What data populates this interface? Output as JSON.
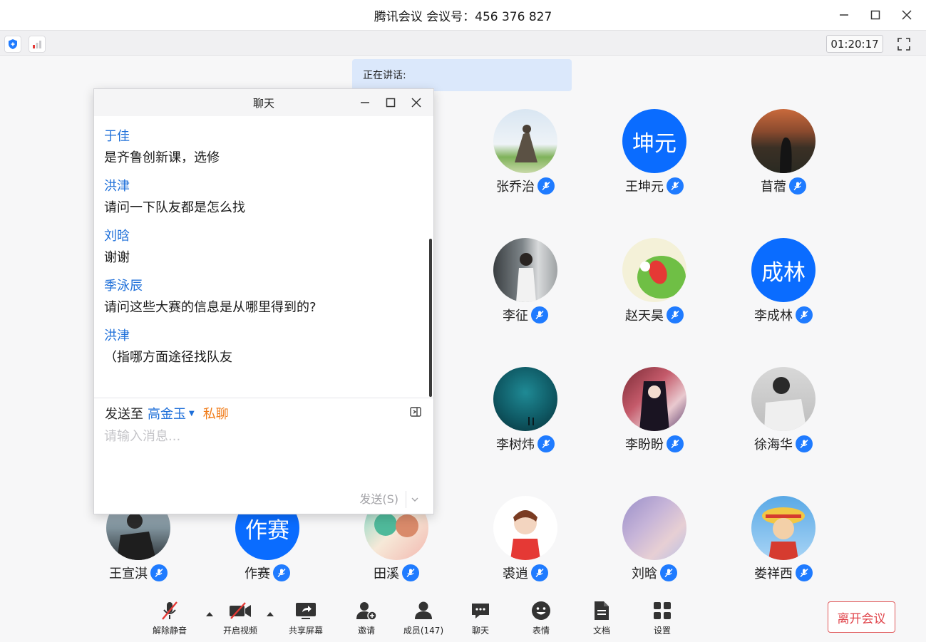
{
  "window": {
    "title": "腾讯会议 会议号：456 376 827"
  },
  "status": {
    "timer": "01:20:17"
  },
  "speaking": {
    "label": "正在讲话:"
  },
  "participants": [
    {
      "name": "张乔治",
      "avatar_text": ""
    },
    {
      "name": "王坤元",
      "avatar_text": "坤元"
    },
    {
      "name": "苜蓿",
      "avatar_text": ""
    },
    {
      "name": "李征",
      "avatar_text": ""
    },
    {
      "name": "赵天昊",
      "avatar_text": ""
    },
    {
      "name": "李成林",
      "avatar_text": "成林"
    },
    {
      "name": "李树炜",
      "avatar_text": ""
    },
    {
      "name": "李盼盼",
      "avatar_text": ""
    },
    {
      "name": "徐海华",
      "avatar_text": ""
    },
    {
      "name": "王宣淇",
      "avatar_text": ""
    },
    {
      "name": "作赛",
      "avatar_text": "作赛"
    },
    {
      "name": "田溪",
      "avatar_text": ""
    },
    {
      "name": "裘逍",
      "avatar_text": ""
    },
    {
      "name": "刘晗",
      "avatar_text": ""
    },
    {
      "name": "娄祥西",
      "avatar_text": ""
    }
  ],
  "chat": {
    "title": "聊天",
    "messages": [
      {
        "sender": "于佳",
        "text": "是齐鲁创新课，选修"
      },
      {
        "sender": "洪津",
        "text": "请问一下队友都是怎么找"
      },
      {
        "sender": "刘晗",
        "text": "谢谢"
      },
      {
        "sender": "季泳辰",
        "text": "请问这些大赛的信息是从哪里得到的?"
      },
      {
        "sender": "洪津",
        "text": "（指哪方面途径找队友"
      }
    ],
    "send_to_label": "发送至",
    "recipient": "高金玉",
    "private_label": "私聊",
    "input_placeholder": "请输入消息...",
    "send_label": "发送(S)"
  },
  "toolbar": {
    "unmute": "解除静音",
    "start_video": "开启视频",
    "share_screen": "共享屏幕",
    "invite": "邀请",
    "members": "成员(147)",
    "chat": "聊天",
    "emoji": "表情",
    "docs": "文档",
    "settings": "设置",
    "leave": "离开会议"
  },
  "colors": {
    "accent": "#0a6cff",
    "chat_sender": "#1e6fd9",
    "private": "#f07c1a",
    "leave": "#e0434a"
  }
}
